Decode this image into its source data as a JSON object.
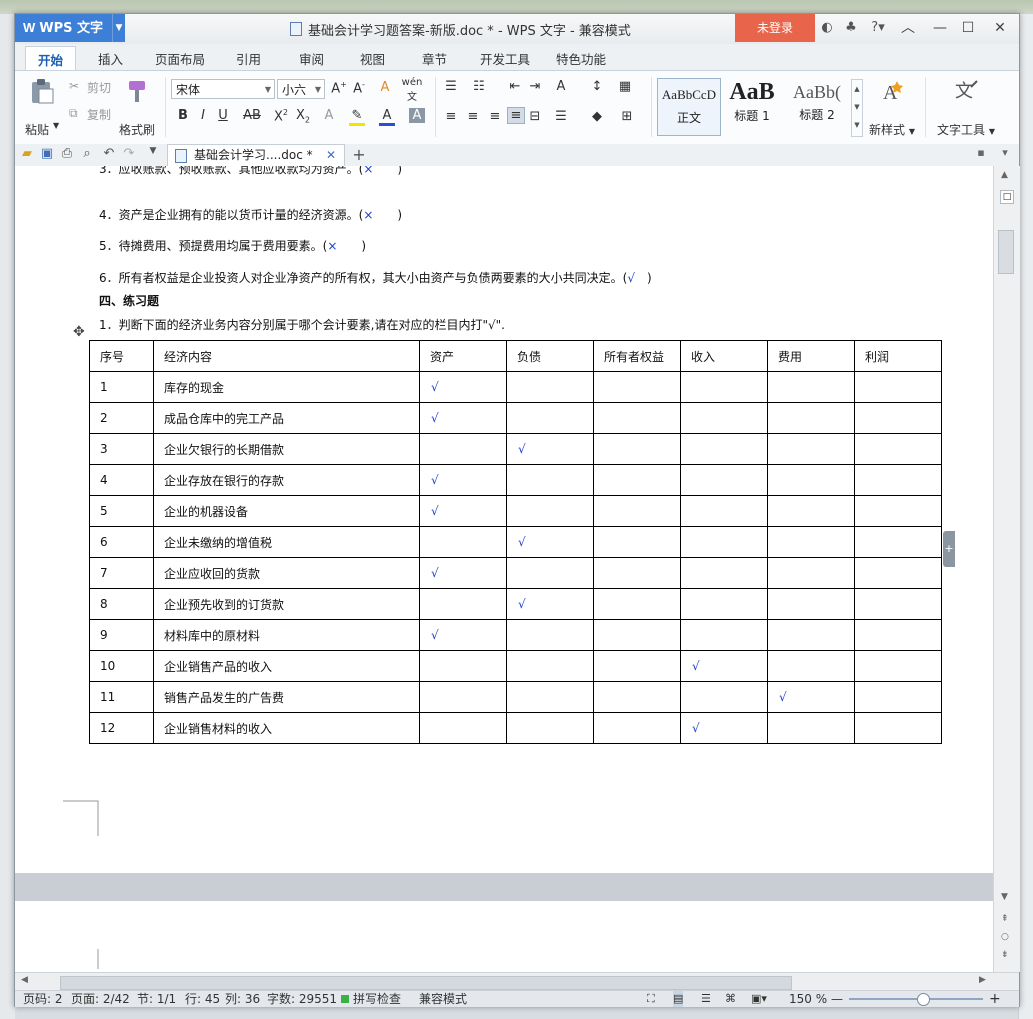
{
  "app": {
    "name": "WPS 文字",
    "document_title": "基础会计学习题答案-新版.doc * - WPS 文字 - 兼容模式",
    "login_label": "未登录",
    "help_label": "?"
  },
  "tabs": [
    "开始",
    "插入",
    "页面布局",
    "引用",
    "审阅",
    "视图",
    "章节",
    "开发工具",
    "特色功能"
  ],
  "ribbon": {
    "paste": "粘贴",
    "cut": "剪切",
    "copy": "复制",
    "format_painter": "格式刷",
    "font_name": "宋体",
    "font_size": "小六",
    "styles": [
      {
        "preview": "AaBbCcD",
        "name": "正文"
      },
      {
        "preview": "AaB",
        "name": "标题 1"
      },
      {
        "preview": "AaBb(",
        "name": "标题 2"
      }
    ],
    "new_style": "新样式",
    "text_tools": "文字工具"
  },
  "quick_bar": {
    "doc_tab": "基础会计学习....doc *",
    "add_tab": "+"
  },
  "document": {
    "line3": "3．应收账款、预收账款、其他应收款均为资产。(",
    "line3_mark": "×",
    "line3_end": ")",
    "line4": "4．资产是企业拥有的能以货币计量的经济资源。(",
    "line4_mark": "×",
    "line4_end": ")",
    "line5": "5．待摊费用、预提费用均属于费用要素。(",
    "line5_mark": "×",
    "line5_end": ")",
    "line6": "6．所有者权益是企业投资人对企业净资产的所有权，其大小由资产与负债两要素的大小共同决定。(",
    "line6_mark": "√",
    "line6_end": ")",
    "section_heading": "四、练习题",
    "exercise": "1．判断下面的经济业务内容分别属于哪个会计要素,请在对应的栏目内打\"√\".",
    "table": {
      "headers": [
        "序号",
        "经济内容",
        "资产",
        "负债",
        "所有者权益",
        "收入",
        "费用",
        "利润"
      ],
      "check_symbol": "√",
      "rows": [
        {
          "no": "1",
          "content": "库存的现金",
          "col": 0
        },
        {
          "no": "2",
          "content": "成品仓库中的完工产品",
          "col": 0
        },
        {
          "no": "3",
          "content": "企业欠银行的长期借款",
          "col": 1
        },
        {
          "no": "4",
          "content": "企业存放在银行的存款",
          "col": 0
        },
        {
          "no": "5",
          "content": "企业的机器设备",
          "col": 0
        },
        {
          "no": "6",
          "content": "企业未缴纳的增值税",
          "col": 1
        },
        {
          "no": "7",
          "content": "企业应收回的货款",
          "col": 0
        },
        {
          "no": "8",
          "content": "企业预先收到的订货款",
          "col": 1
        },
        {
          "no": "9",
          "content": "材料库中的原材料",
          "col": 0
        },
        {
          "no": "10",
          "content": "企业销售产品的收入",
          "col": 3
        },
        {
          "no": "11",
          "content": "销售产品发生的广告费",
          "col": 4
        },
        {
          "no": "12",
          "content": "企业销售材料的收入",
          "col": 3
        }
      ]
    }
  },
  "status": {
    "page_code": "页码: 2",
    "pages": "页面: 2/42",
    "section": "节: 1/1",
    "row": "行: 45",
    "col": "列: 36",
    "words": "字数: 29551",
    "spell": "拼写检查",
    "compat": "兼容模式",
    "zoom": "150 %"
  },
  "colors": {
    "accent": "#3d7fd6",
    "login": "#e8644a",
    "mark": "#1b3fd0"
  }
}
